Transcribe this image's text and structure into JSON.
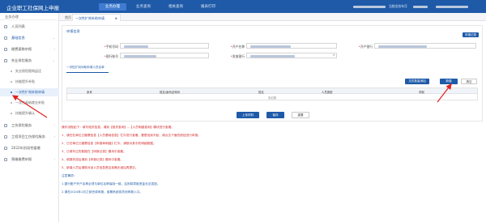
{
  "header": {
    "brand": "企业职工社保网上申报",
    "nav": [
      "业务办理",
      "业务查询",
      "相关查询",
      "报表打印"
    ],
    "current_period_label": "当前业务年月"
  },
  "sidebar": {
    "heading": "业务办理",
    "items": [
      {
        "label": "人员列表",
        "has_arrow": false
      },
      {
        "label": "基础信息",
        "has_arrow": true
      },
      {
        "label": "缴费基数申报",
        "has_arrow": true
      },
      {
        "label": "失业保险服务",
        "has_arrow": true
      }
    ],
    "subitems": [
      "失业保险稳岗返还",
      "技能提升补贴",
      "一次性扩岗补助申请",
      "一次性吸纳就业补贴",
      "技能提升确认"
    ],
    "items_bottom": [
      {
        "label": "工伤保险服务",
        "has_arrow": true
      },
      {
        "label": "工程项目工伤保险服务",
        "has_arrow": true
      },
      {
        "label": "2022年阶段性缓缴",
        "has_arrow": false
      },
      {
        "label": "预缴缴费申报",
        "has_arrow": true
      }
    ]
  },
  "page_tabs": {
    "home": "首页",
    "current": "一次性扩岗补助申请",
    "close": "⊗"
  },
  "form": {
    "section_title": "申报信息",
    "top_right_button": "申报记录",
    "fields_row1": [
      {
        "label": "手机号码",
        "required": true
      },
      {
        "label": "开户名称",
        "required": true
      },
      {
        "label": "开户银行",
        "required": true
      }
    ],
    "fields_row2": [
      {
        "label": "银行账号",
        "required": true
      },
      {
        "label": "发放银行",
        "required": true
      }
    ],
    "subtab": "一次性扩岗补助申请人员名单"
  },
  "toolbar": {
    "import": "文件批量添加",
    "add": "新增",
    "clear": "清空"
  },
  "table": {
    "headers": [
      "序号",
      "姓名/身份证号码",
      "姓名",
      "人员类型",
      "学制"
    ],
    "empty_text": "无记录"
  },
  "actions": {
    "upload": "上传材料",
    "save": "保存",
    "reset": "重置"
  },
  "notes": {
    "intro": "操作流程如下：填写相关信息，请到【相关查询】--【人员明细查询】模块进行查看。",
    "red_lines": [
      "1、请在在单位已缴费信息【人员基础信息】栏中进行查看，要是找到不起，请点击下面的按钮进行申报。",
      "2、已在单位已缴费信息【申报单明细】栏中，请核对其中的明细数据。",
      "3、已填写过的数据在【申报记录】模块中查看。",
      "4、填报完成后请到【申报记录】模块中查看。",
      "5、新增人员后请核对该人员信息是否准确无误后再提交。"
    ],
    "attention_title": "注意事项：",
    "blue_lines": [
      "1.银行账户开户名称必须与单位名称保持一致，否则将导致资金无法发放。",
      "2.请在2024年1月之前完成申报，逾期系统将关闭申报入口。"
    ]
  }
}
